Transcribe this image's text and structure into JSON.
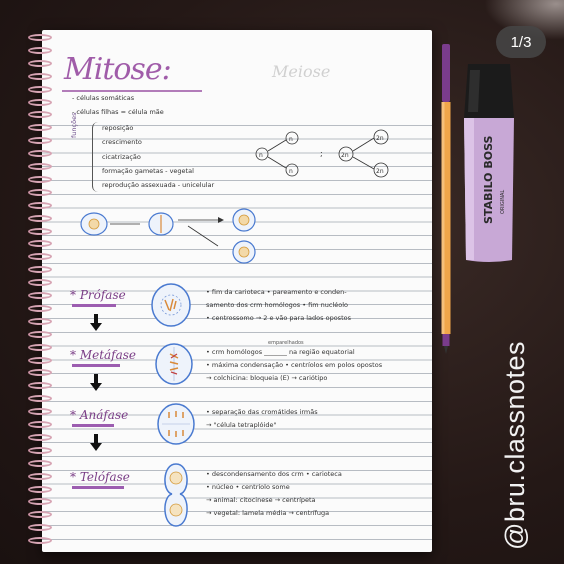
{
  "badge": {
    "text": "1/3"
  },
  "watermark": {
    "text": "@bru.classnotes"
  },
  "notebook": {
    "title": "Mitose:",
    "ghost_text": "Meiose",
    "intro": {
      "line1": "- células somáticas",
      "line2": "- células filhas = célula mãe",
      "functions_label": "funções",
      "functions": [
        "reposição",
        "crescimento",
        "cicatrização",
        "formação gametas - vegetal",
        "reprodução assexuada - unicelular"
      ]
    },
    "diagram_labels": {
      "n": "n",
      "two_n": "2n",
      "sep": ";"
    },
    "phases": [
      {
        "title": "* Prófase",
        "notes": [
          "• fim da carioteca • pareamento e conden-",
          "samento dos crm homólogos • fim nucléolo",
          "• centrossomo → 2 e vão para lados opostos"
        ]
      },
      {
        "title": "* Metáfase",
        "notes": [
          "• crm homólogos _______ na região equatorial",
          "• máxima condensação • centríolos em polos opostos",
          "→ colchicina: bloqueia (E) → cariótipo"
        ],
        "sup": "emparelhados"
      },
      {
        "title": "* Anáfase",
        "notes": [
          "• separação das cromátides irmãs",
          "→ \"célula tetraplóide\""
        ]
      },
      {
        "title": "* Telófase",
        "notes": [
          "• descondensamento dos crm • carioteca",
          "• núcleo • centríolo some",
          "→ animal: citocinese → centrípeta",
          "→ vegetal: lamela média → centrífuga"
        ]
      }
    ]
  },
  "marker": {
    "brand": "STABILO BOSS",
    "sub": "ORIGINAL"
  },
  "colors": {
    "purple": "#a05ca9",
    "cell_blue": "#4a7ad0",
    "pen_orange": "#f0a64a",
    "marker_lilac": "#c8a8d6"
  }
}
